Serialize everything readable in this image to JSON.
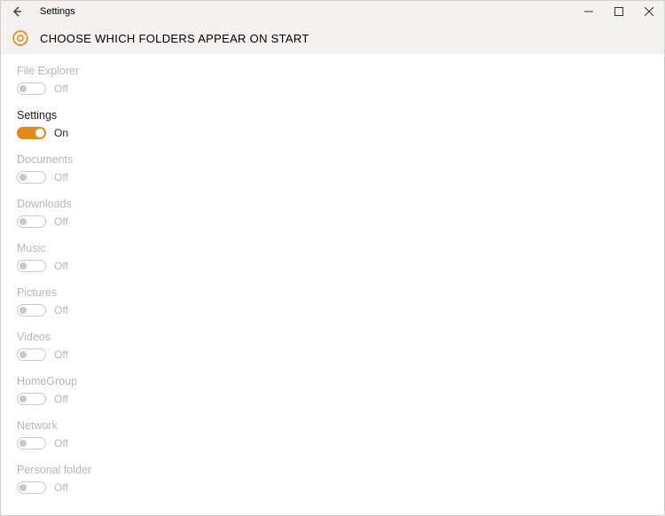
{
  "window": {
    "title": "Settings"
  },
  "page": {
    "heading": "CHOOSE WHICH FOLDERS APPEAR ON START"
  },
  "toggle_labels": {
    "on": "On",
    "off": "Off"
  },
  "folders": [
    {
      "name": "File Explorer",
      "enabled": false
    },
    {
      "name": "Settings",
      "enabled": true
    },
    {
      "name": "Documents",
      "enabled": false
    },
    {
      "name": "Downloads",
      "enabled": false
    },
    {
      "name": "Music",
      "enabled": false
    },
    {
      "name": "Pictures",
      "enabled": false
    },
    {
      "name": "Videos",
      "enabled": false
    },
    {
      "name": "HomeGroup",
      "enabled": false
    },
    {
      "name": "Network",
      "enabled": false
    },
    {
      "name": "Personal folder",
      "enabled": false
    }
  ],
  "colors": {
    "accent": "#e08a1e"
  }
}
